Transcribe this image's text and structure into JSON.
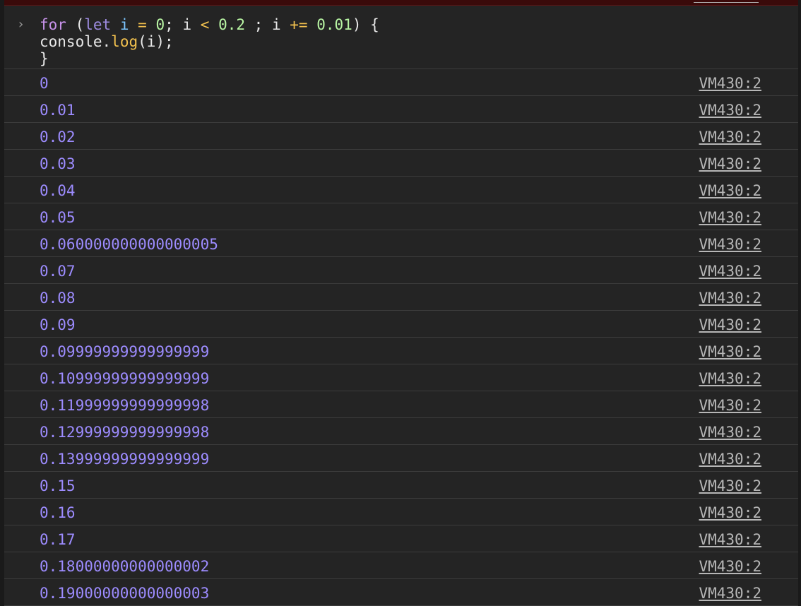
{
  "input": {
    "prompt_icon": "chevron-right-icon",
    "line1": {
      "kw_for": "for",
      "paren_open": "(",
      "kw_let": "let",
      "var_i": "i",
      "op_assign": "=",
      "num_zero": "0",
      "semi1": ";",
      "var_i2": "i",
      "op_lt": "<",
      "num_limit": "0.2",
      "semi2": ";",
      "var_i3": "i",
      "op_add": "+=",
      "num_step": "0.01",
      "paren_close": ")",
      "brace_open": "{"
    },
    "line2": {
      "obj": "console",
      "dot": ".",
      "method": "log",
      "args": "(i);"
    },
    "line3": {
      "brace_close": "}"
    }
  },
  "logs": [
    {
      "value": "0",
      "source": "VM430:2"
    },
    {
      "value": "0.01",
      "source": "VM430:2"
    },
    {
      "value": "0.02",
      "source": "VM430:2"
    },
    {
      "value": "0.03",
      "source": "VM430:2"
    },
    {
      "value": "0.04",
      "source": "VM430:2"
    },
    {
      "value": "0.05",
      "source": "VM430:2"
    },
    {
      "value": "0.060000000000000005",
      "source": "VM430:2"
    },
    {
      "value": "0.07",
      "source": "VM430:2"
    },
    {
      "value": "0.08",
      "source": "VM430:2"
    },
    {
      "value": "0.09",
      "source": "VM430:2"
    },
    {
      "value": "0.09999999999999999",
      "source": "VM430:2"
    },
    {
      "value": "0.10999999999999999",
      "source": "VM430:2"
    },
    {
      "value": "0.11999999999999998",
      "source": "VM430:2"
    },
    {
      "value": "0.12999999999999998",
      "source": "VM430:2"
    },
    {
      "value": "0.13999999999999999",
      "source": "VM430:2"
    },
    {
      "value": "0.15",
      "source": "VM430:2"
    },
    {
      "value": "0.16",
      "source": "VM430:2"
    },
    {
      "value": "0.17",
      "source": "VM430:2"
    },
    {
      "value": "0.18000000000000002",
      "source": "VM430:2"
    },
    {
      "value": "0.19000000000000003",
      "source": "VM430:2"
    }
  ],
  "colors": {
    "background": "#242424",
    "value_text": "#9d8cff",
    "source_link": "#b7b7b7",
    "row_divider": "#3c3c3c"
  }
}
